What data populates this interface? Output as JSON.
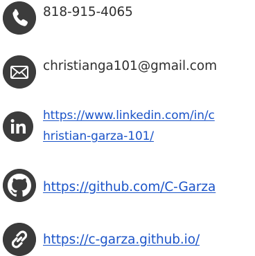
{
  "contacts": {
    "phone": {
      "icon": "phone-icon",
      "text": "818-915-4065"
    },
    "email": {
      "icon": "mail-icon",
      "text": "christianga101@gmail.com"
    },
    "linkedin": {
      "icon": "linkedin-icon",
      "line1": "https://www.linkedin.com/in/c",
      "line2": "hristian-garza-101/"
    },
    "github": {
      "icon": "github-icon",
      "text": "https://github.com/C-Garza"
    },
    "website": {
      "icon": "link-icon",
      "text": "https://c-garza.github.io/"
    }
  },
  "colors": {
    "icon_bg": "#3c3c3c",
    "text": "#2f2f2f",
    "link": "#1a53c8"
  }
}
